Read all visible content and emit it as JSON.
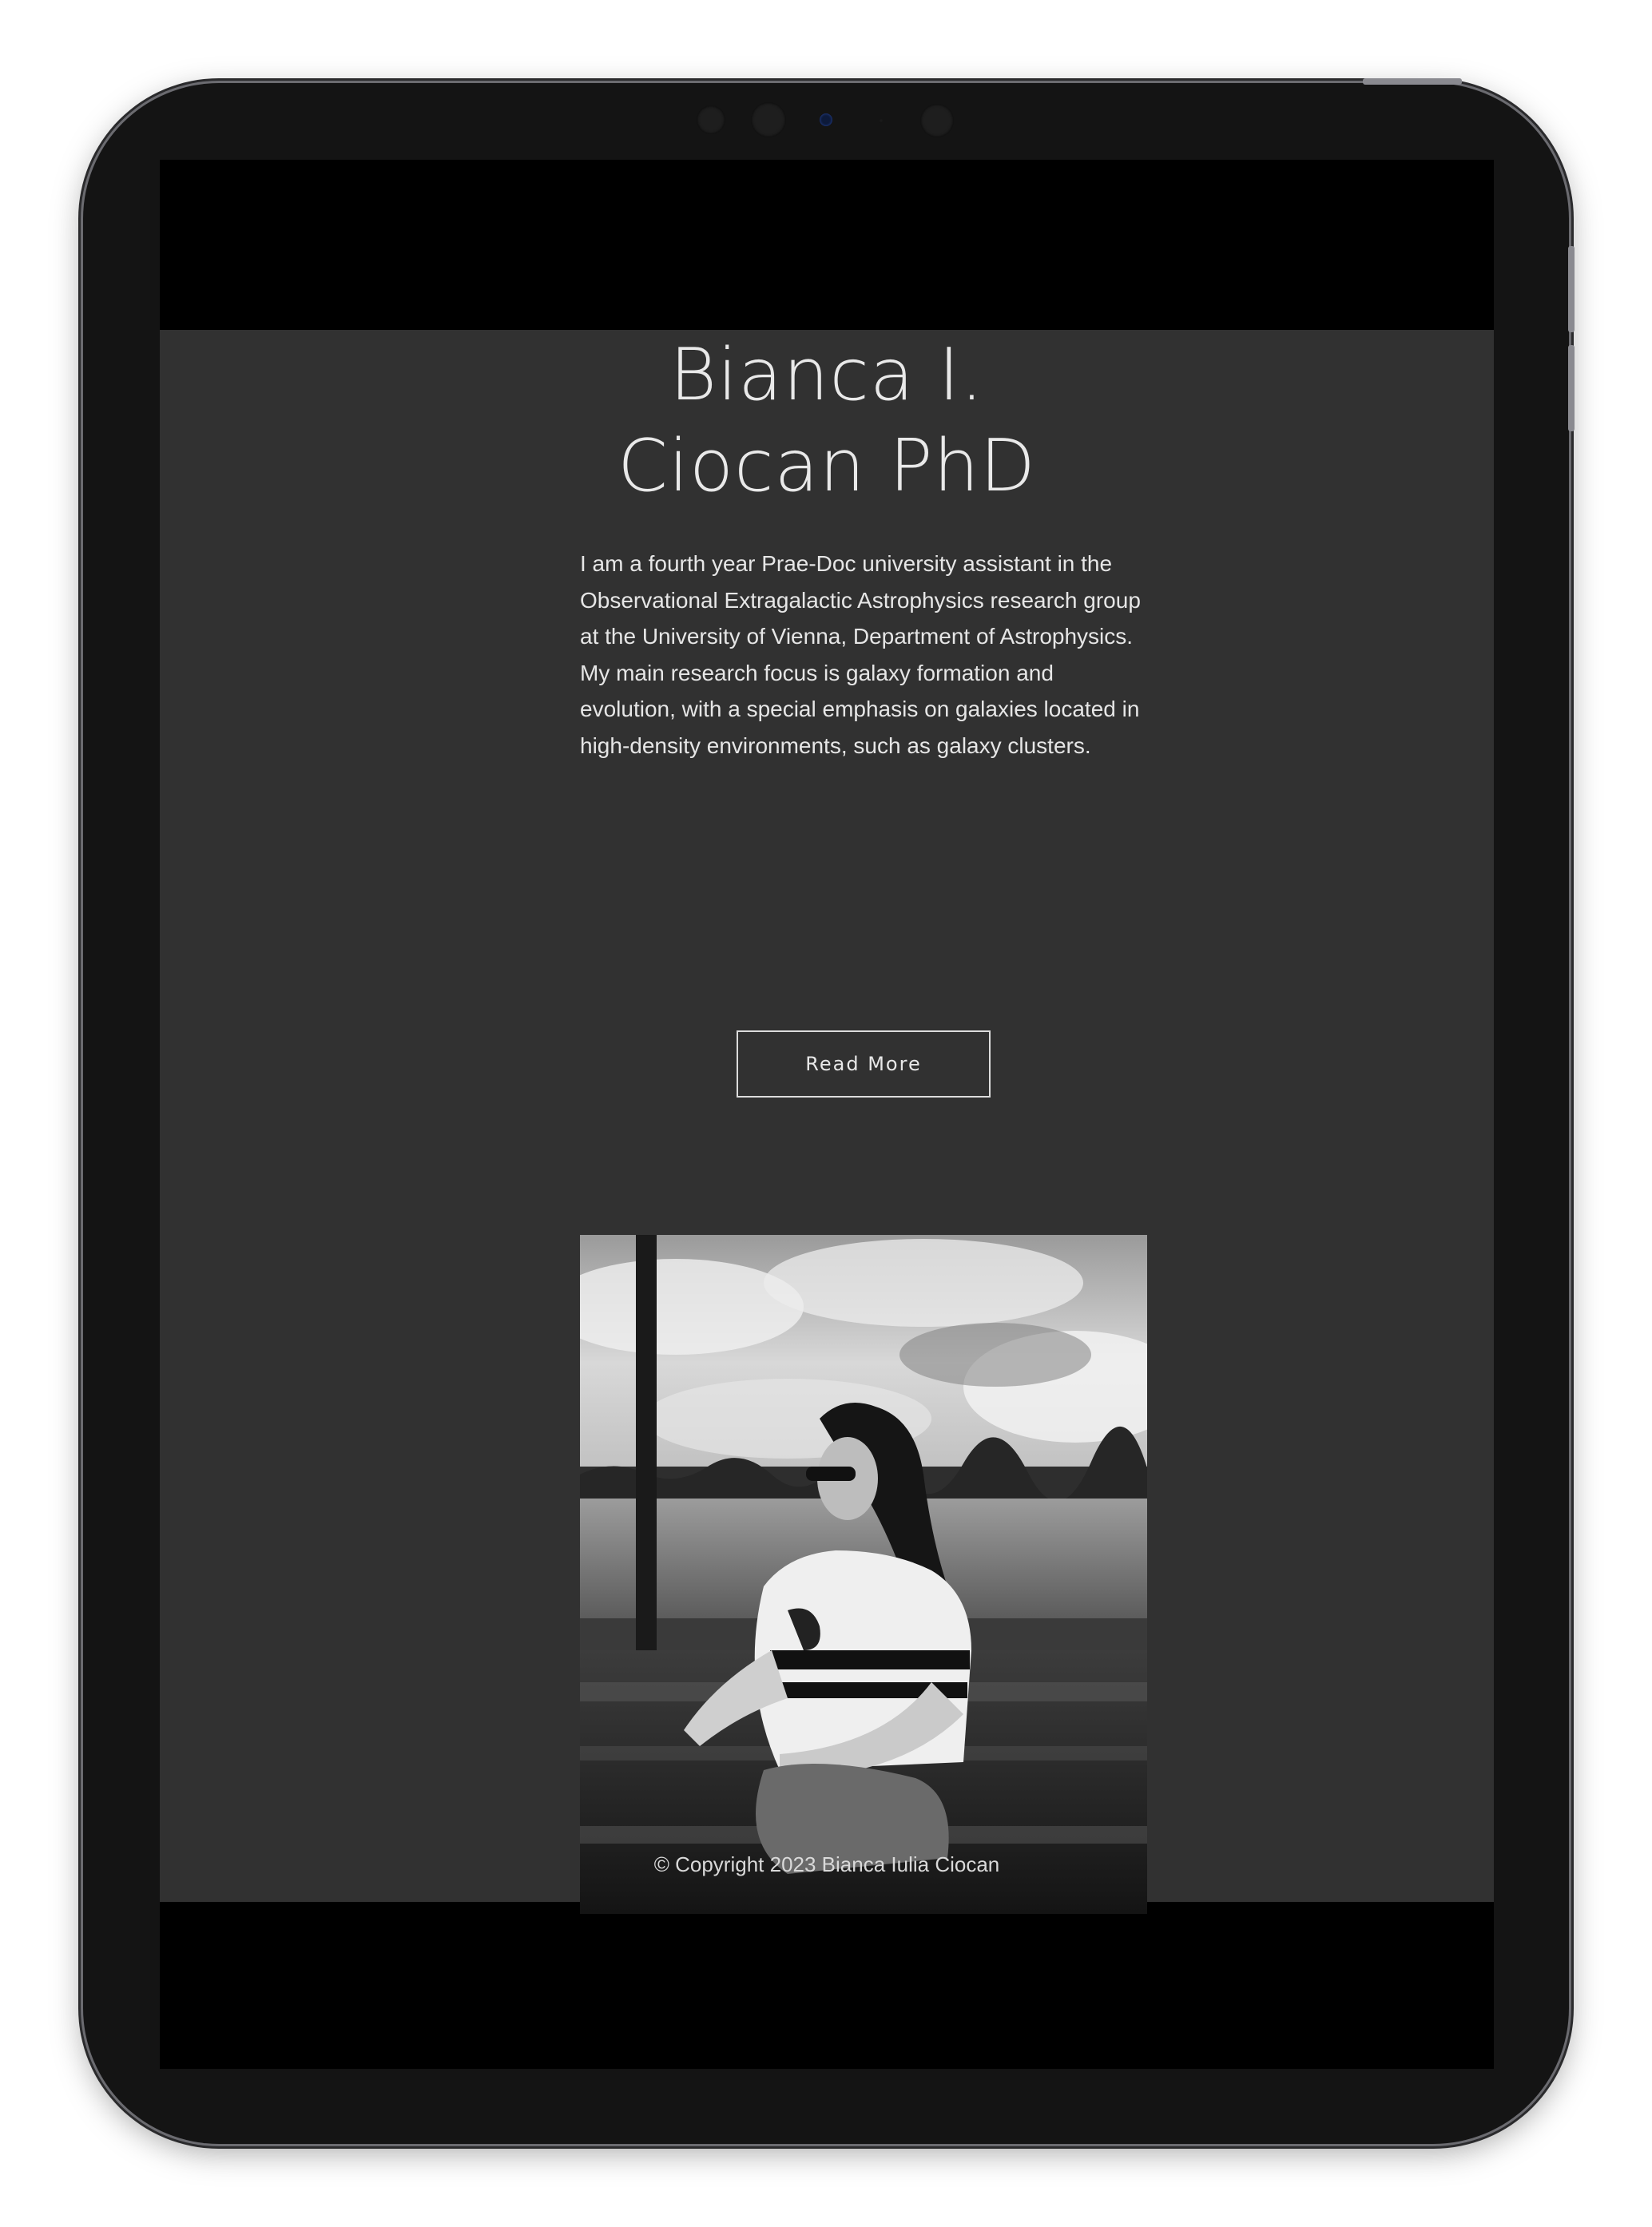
{
  "profile": {
    "name_line1": "Bianca I.",
    "name_line2": "Ciocan PhD",
    "bio": "I am a fourth year Prae-Doc university assistant in the Observational Extragalactic Astrophysics research group at the University of Vienna, Department of Astrophysics. My main research focus is galaxy formation and evolution, with a special emphasis on galaxies located in high-density environments, such as galaxy clusters.",
    "read_more_label": "Read More",
    "photo_icon": "portrait-photo"
  },
  "footer": {
    "copyright": "© Copyright 2023 Bianca Iulia Ciocan"
  },
  "colors": {
    "page_background": "#313131",
    "letterbox": "#000000",
    "text": "#e6e6e6",
    "device_frame": "#141414"
  }
}
